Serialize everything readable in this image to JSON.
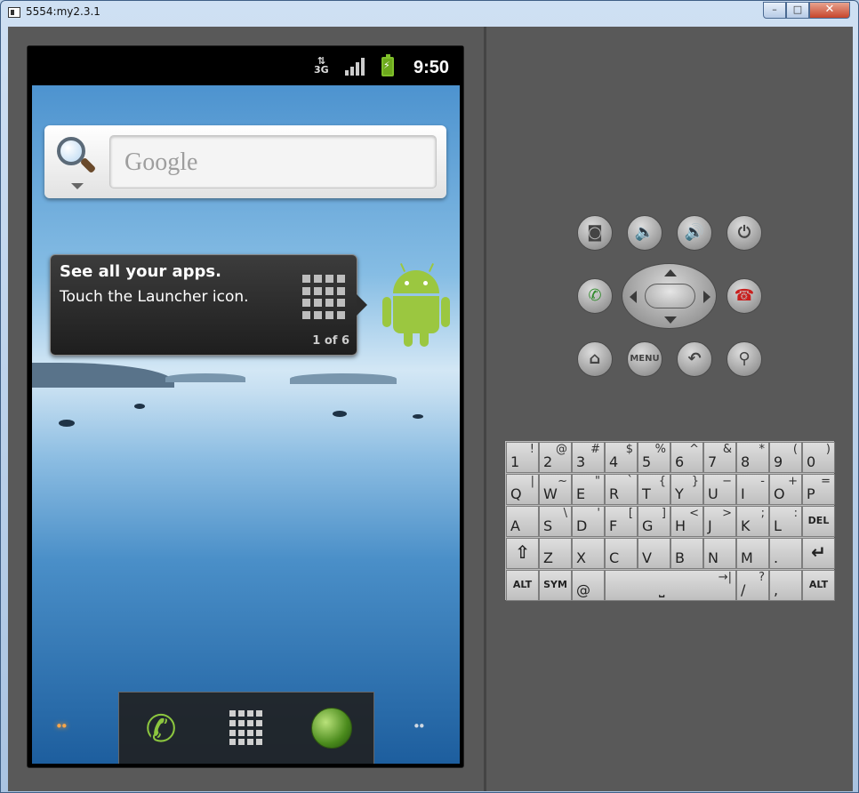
{
  "window": {
    "title": "5554:my2.3.1",
    "min": "–",
    "max": "□",
    "close": "✕"
  },
  "statusbar": {
    "network": "3G",
    "time": "9:50"
  },
  "search": {
    "placeholder": "Google"
  },
  "tip": {
    "title": "See all your apps.",
    "body": "Touch the Launcher icon.",
    "counter": "1 of 6"
  },
  "dock": {
    "dots_left": "••",
    "dots_right": "••"
  },
  "controls": {
    "menu_label": "MENU"
  },
  "keyboard": {
    "row1": [
      [
        "1",
        "!"
      ],
      [
        "2",
        "@"
      ],
      [
        "3",
        "#"
      ],
      [
        "4",
        "$"
      ],
      [
        "5",
        "%"
      ],
      [
        "6",
        "^"
      ],
      [
        "7",
        "&"
      ],
      [
        "8",
        "*"
      ],
      [
        "9",
        "("
      ],
      [
        "0",
        ")"
      ]
    ],
    "row2": [
      [
        "Q",
        "|"
      ],
      [
        "W",
        "~"
      ],
      [
        "E",
        "\""
      ],
      [
        "R",
        "`"
      ],
      [
        "T",
        "{"
      ],
      [
        "Y",
        "}"
      ],
      [
        "U",
        "−"
      ],
      [
        "I",
        "-"
      ],
      [
        "O",
        "+"
      ],
      [
        "P",
        "="
      ]
    ],
    "row3": [
      [
        "A",
        ""
      ],
      [
        "S",
        "\\"
      ],
      [
        "D",
        "'"
      ],
      [
        "F",
        "["
      ],
      [
        "G",
        "]"
      ],
      [
        "H",
        "<"
      ],
      [
        "J",
        ">"
      ],
      [
        "K",
        ";"
      ],
      [
        "L",
        ":"
      ],
      [
        "DEL",
        ""
      ]
    ],
    "row4": [
      [
        "⇧",
        ""
      ],
      [
        "Z",
        ""
      ],
      [
        "X",
        ""
      ],
      [
        "C",
        ""
      ],
      [
        "V",
        ""
      ],
      [
        "B",
        ""
      ],
      [
        "N",
        ""
      ],
      [
        "M",
        ""
      ],
      [
        ".",
        ""
      ],
      [
        "↵",
        ""
      ]
    ],
    "row5": [
      [
        "ALT",
        ""
      ],
      [
        "SYM",
        ""
      ],
      [
        "@",
        ""
      ],
      [
        "⎵",
        "→|"
      ],
      [
        "/",
        "?"
      ],
      [
        ",",
        ""
      ],
      [
        "ALT",
        ""
      ]
    ]
  },
  "colors": {
    "accent_green": "#9bc740",
    "end_call": "#c8201e",
    "call": "#2f8a2a"
  },
  "icons": [
    "search-icon",
    "launcher-icon",
    "android-icon",
    "phone-icon",
    "browser-icon",
    "camera-icon",
    "volume-down-icon",
    "volume-up-icon",
    "power-icon",
    "call-icon",
    "end-call-icon",
    "home-icon",
    "back-icon",
    "search-button-icon",
    "shift-icon",
    "enter-icon",
    "del-icon"
  ]
}
